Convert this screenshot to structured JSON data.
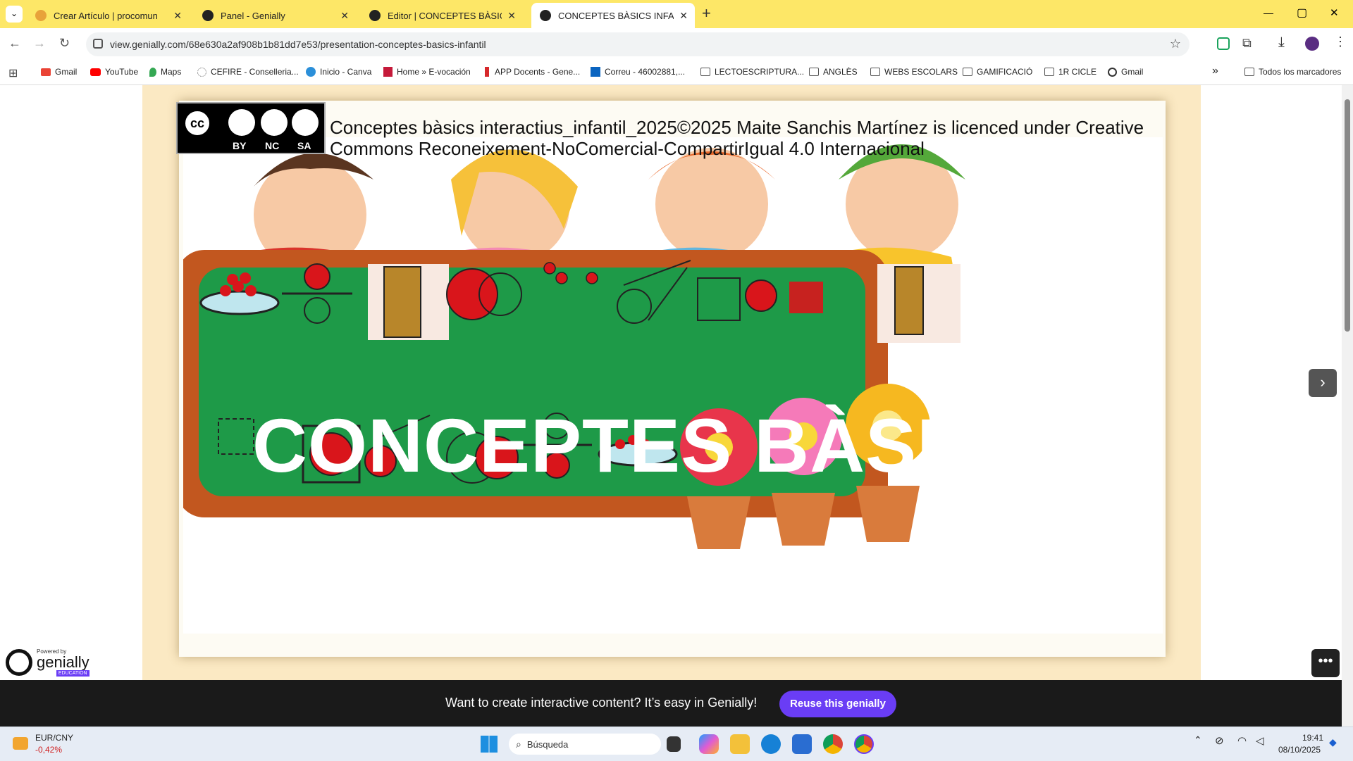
{
  "browser": {
    "tabs": [
      {
        "title": "Crear Artículo | procomun",
        "active": false,
        "favicon_color": "#e8a23a"
      },
      {
        "title": "Panel - Genially",
        "active": false,
        "favicon_color": "#222222"
      },
      {
        "title": "Editor | CONCEPTES BÀSICS INF",
        "active": false,
        "favicon_color": "#222222"
      },
      {
        "title": "CONCEPTES BÀSICS INFANTIL |",
        "active": true,
        "favicon_color": "#222222"
      }
    ],
    "new_tab_label": "+",
    "window_controls": {
      "minimize": "—",
      "maximize": "▢",
      "close": "✕"
    },
    "url": "view.genially.com/68e630a2af908b1b81dd7e53/presentation-conceptes-basics-infantil",
    "bookmarks": [
      {
        "label": "Gmail",
        "icon": "gmail-icon"
      },
      {
        "label": "YouTube",
        "icon": "youtube-icon"
      },
      {
        "label": "Maps",
        "icon": "maps-icon"
      },
      {
        "label": "CEFIRE - Conselleria...",
        "icon": "globe-icon"
      },
      {
        "label": "Inicio - Canva",
        "icon": "canva-icon"
      },
      {
        "label": "Home » E-vocación",
        "icon": "evocacion-icon"
      },
      {
        "label": "APP Docents - Gene...",
        "icon": "gva-icon"
      },
      {
        "label": "Correu - 46002881,...",
        "icon": "outlook-icon"
      },
      {
        "label": "LECTOESCRIPTURA...",
        "icon": "folder-icon"
      },
      {
        "label": "ANGLÈS",
        "icon": "folder-icon"
      },
      {
        "label": "WEBS ESCOLARS",
        "icon": "folder-icon"
      },
      {
        "label": "GAMIFICACIÓ",
        "icon": "folder-icon"
      },
      {
        "label": "1R CICLE",
        "icon": "folder-icon"
      },
      {
        "label": "Gmail",
        "icon": "globe-icon"
      }
    ],
    "bookmarks_overflow": "»",
    "all_bookmarks": "Todos los marcadores"
  },
  "slide": {
    "license_text": "Conceptes bàsics interactius_infantil_2025©2025  Maite Sanchis Martínez is licenced under Creative Commons Reconeixement-NoComercial-CompartirIgual 4.0 Internacional",
    "cc_labels": [
      "BY",
      "NC",
      "SA"
    ],
    "title": "CONCEPTES BÀSICS",
    "board_color": "#1e9a48",
    "frame_color": "#c2571f"
  },
  "genially": {
    "powered_by": "Powered by",
    "brand": "genially",
    "edition": "EDUCATION",
    "next_label": "›",
    "more_label": "•••"
  },
  "banner": {
    "text": "Want to create interactive content? It’s easy in Genially!",
    "button": "Reuse this genially"
  },
  "taskbar": {
    "ticker_name": "EUR/CNY",
    "ticker_value": "-0,42%",
    "search_placeholder": "Búsqueda",
    "time": "19:41",
    "date": "08/10/2025"
  }
}
